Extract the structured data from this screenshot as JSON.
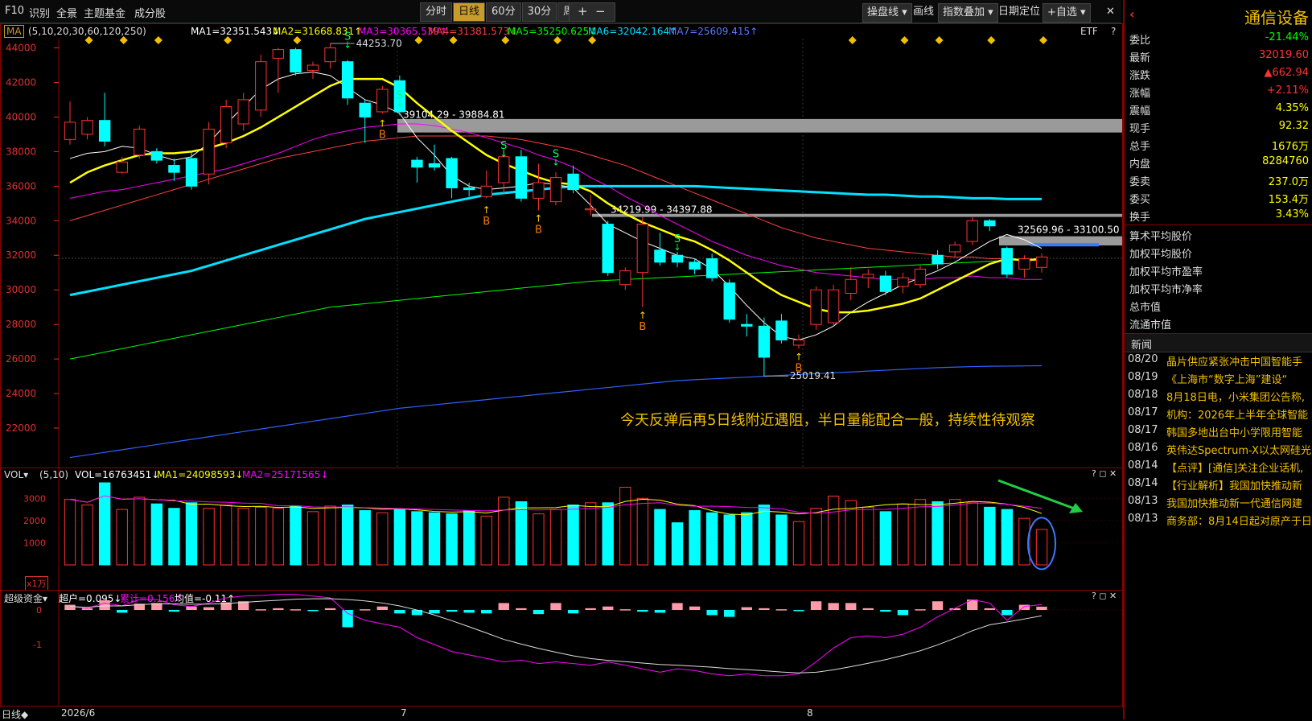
{
  "toolbar": {
    "nav": [
      "F10",
      "识别",
      "全景",
      "主题基金",
      "成分股"
    ],
    "timeframes": [
      "分时",
      "日线",
      "60分",
      "30分",
      "周线"
    ],
    "active_timeframe": "日线",
    "plus": "+",
    "minus": "−",
    "tools": [
      "操盘线",
      "画线",
      "指数叠加",
      "日期定位",
      "+自选"
    ],
    "close": "✕"
  },
  "main_indicator": {
    "name": "MA",
    "params": "(5,10,20,30,60,120,250)",
    "ma1": "MA1=32351.543↓",
    "ma2": "MA2=31668.831↑",
    "ma3": "MA3=30365.539↑",
    "ma4": "MA4=31381.573↓",
    "ma5": "MA5=35250.625↓",
    "ma6": "MA6=32042.164↑",
    "ma7": "MA7=25609.415↑",
    "etf": "ETF",
    "help": "?"
  },
  "price_axis": [
    "44000",
    "42000",
    "40000",
    "38000",
    "36000",
    "34000",
    "32000",
    "30000",
    "28000",
    "26000",
    "24000",
    "22000"
  ],
  "annotations": {
    "high": "44253.70",
    "zone1": "39104.29 - 39884.81",
    "zone2": "34219.99 - 34397.88",
    "zone3": "32569.96 - 33100.50",
    "low": "25019.41",
    "comment": "今天反弹后再5日线附近遇阻，半日量能配合一般，持续性待观察"
  },
  "vol_indicator": {
    "name": "VOL",
    "params": "(5,10)",
    "vol": "VOL=16763451↓",
    "ma1": "MA1=24098593↓",
    "ma2": "MA2=25171565↓",
    "axis": [
      "3000",
      "2000",
      "1000"
    ],
    "unit": "x1万"
  },
  "fund_indicator": {
    "name": "超级资金",
    "super": "超户=0.095↓",
    "cum": "累计=0.156↑",
    "avg": "均值=-0.11↑",
    "axis": [
      "0",
      "-1"
    ]
  },
  "date_axis": {
    "mode": "日线◆",
    "labels": [
      "2026/6",
      "7",
      "8"
    ]
  },
  "colors": {
    "up": "#ff3232",
    "down": "#00ffff",
    "ma5": "#ffffff",
    "ma10": "#ffff00",
    "ma20": "#ff00ff",
    "ma30": "#ff4040",
    "ma60": "#00ff00",
    "ma120": "#00e0ff",
    "ma250": "#3060ff",
    "accent": "#c89b2a"
  },
  "quote": {
    "name": "通信设备",
    "rows": [
      {
        "k": "委比",
        "v": "-21.44%",
        "c": "#00ff00"
      },
      {
        "k": "最新",
        "v": "32019.60",
        "c": "#ff3232"
      },
      {
        "k": "涨跌",
        "v": "▲662.94",
        "c": "#ff3232"
      },
      {
        "k": "涨幅",
        "v": "+2.11%",
        "c": "#ff3232"
      },
      {
        "k": "震幅",
        "v": "4.35%",
        "c": "#ffff00"
      },
      {
        "k": "现手",
        "v": "92.32",
        "c": "#ffff00"
      },
      {
        "k": "总手",
        "v": "1676万",
        "c": "#ffff00"
      },
      {
        "k": "内盘",
        "v": "8284760",
        "c": "#ffff00"
      },
      {
        "k": "委卖",
        "v": "237.0万",
        "c": "#ffff00"
      },
      {
        "k": "委买",
        "v": "153.4万",
        "c": "#ffff00"
      },
      {
        "k": "换手",
        "v": "3.43%",
        "c": "#ffff00"
      }
    ],
    "stats": [
      "算术平均股价",
      "加权平均股价",
      "加权平均市盈率",
      "加权平均市净率",
      "总市值",
      "流通市值"
    ]
  },
  "news": {
    "title": "新闻",
    "items": [
      {
        "d": "08/20",
        "t": "晶片供应紧张冲击中国智能手"
      },
      {
        "d": "08/19",
        "t": "《上海市“数字上海”建设“"
      },
      {
        "d": "08/18",
        "t": "8月18日电，小米集团公告称,"
      },
      {
        "d": "08/17",
        "t": "机构：2026年上半年全球智能"
      },
      {
        "d": "08/17",
        "t": "韩国多地出台中小学限用智能"
      },
      {
        "d": "08/16",
        "t": "英伟达Spectrum-X以太网硅光"
      },
      {
        "d": "08/14",
        "t": "【点评】[通信]关注企业话机,"
      },
      {
        "d": "08/14",
        "t": "【行业解析】我国加快推动新"
      },
      {
        "d": "08/13",
        "t": "我国加快推动新一代通信网建"
      },
      {
        "d": "08/13",
        "t": "商务部：8月14日起对原产于日"
      }
    ]
  },
  "chart_data": {
    "type": "candlestick",
    "title": "",
    "ylim": [
      20000,
      45000
    ],
    "x_labels": [
      "2026/6",
      "7",
      "8"
    ],
    "candles": [
      {
        "o": 38700,
        "c": 39700,
        "h": 40900,
        "l": 38400
      },
      {
        "o": 39000,
        "c": 39800,
        "h": 40000,
        "l": 38700
      },
      {
        "o": 39800,
        "c": 38600,
        "h": 41400,
        "l": 38300
      },
      {
        "o": 36800,
        "c": 37400,
        "h": 37700,
        "l": 36700
      },
      {
        "o": 37800,
        "c": 39300,
        "h": 39500,
        "l": 37600
      },
      {
        "o": 38000,
        "c": 37500,
        "h": 38200,
        "l": 37300
      },
      {
        "o": 37200,
        "c": 36800,
        "h": 37600,
        "l": 36300
      },
      {
        "o": 37600,
        "c": 36000,
        "h": 38000,
        "l": 35800
      },
      {
        "o": 36700,
        "c": 39300,
        "h": 39700,
        "l": 36100
      },
      {
        "o": 38500,
        "c": 40600,
        "h": 41000,
        "l": 38200
      },
      {
        "o": 39600,
        "c": 41000,
        "h": 41400,
        "l": 39200
      },
      {
        "o": 40400,
        "c": 43200,
        "h": 43600,
        "l": 40000
      },
      {
        "o": 43400,
        "c": 43900,
        "h": 44000,
        "l": 41400
      },
      {
        "o": 43900,
        "c": 42600,
        "h": 44000,
        "l": 42400
      },
      {
        "o": 42700,
        "c": 43000,
        "h": 43200,
        "l": 42200
      },
      {
        "o": 43200,
        "c": 44000,
        "h": 44253,
        "l": 42800
      },
      {
        "o": 43200,
        "c": 41100,
        "h": 43300,
        "l": 40700
      },
      {
        "o": 40800,
        "c": 40000,
        "h": 41000,
        "l": 38500
      },
      {
        "o": 40300,
        "c": 41600,
        "h": 41800,
        "l": 40200
      },
      {
        "o": 42100,
        "c": 40300,
        "h": 42400,
        "l": 40100
      },
      {
        "o": 37500,
        "c": 37100,
        "h": 37700,
        "l": 36200
      },
      {
        "o": 37300,
        "c": 37100,
        "h": 38400,
        "l": 36900
      },
      {
        "o": 37600,
        "c": 35900,
        "h": 37700,
        "l": 35300
      },
      {
        "o": 35900,
        "c": 35800,
        "h": 36200,
        "l": 35400
      },
      {
        "o": 35400,
        "c": 36000,
        "h": 36900,
        "l": 35300
      },
      {
        "o": 36200,
        "c": 37700,
        "h": 38200,
        "l": 35600
      },
      {
        "o": 37700,
        "c": 35300,
        "h": 38100,
        "l": 35100
      },
      {
        "o": 35300,
        "c": 36200,
        "h": 37300,
        "l": 34600
      },
      {
        "o": 35100,
        "c": 36500,
        "h": 36800,
        "l": 34900
      },
      {
        "o": 36700,
        "c": 35800,
        "h": 37200,
        "l": 35600
      },
      {
        "o": 34700,
        "c": 34700,
        "h": 35500,
        "l": 34300
      },
      {
        "o": 33800,
        "c": 31000,
        "h": 34000,
        "l": 30800
      },
      {
        "o": 30300,
        "c": 31100,
        "h": 31300,
        "l": 30000
      },
      {
        "o": 31000,
        "c": 33800,
        "h": 34200,
        "l": 29000
      },
      {
        "o": 32300,
        "c": 31600,
        "h": 33300,
        "l": 31400
      },
      {
        "o": 32000,
        "c": 31600,
        "h": 32200,
        "l": 31300
      },
      {
        "o": 31600,
        "c": 31200,
        "h": 31800,
        "l": 30900
      },
      {
        "o": 31800,
        "c": 30700,
        "h": 32100,
        "l": 30500
      },
      {
        "o": 30400,
        "c": 28300,
        "h": 30600,
        "l": 28100
      },
      {
        "o": 28000,
        "c": 27900,
        "h": 28600,
        "l": 27300
      },
      {
        "o": 27900,
        "c": 26100,
        "h": 28400,
        "l": 25019
      },
      {
        "o": 28200,
        "c": 27100,
        "h": 28600,
        "l": 26900
      },
      {
        "o": 26800,
        "c": 27100,
        "h": 27400,
        "l": 26600
      },
      {
        "o": 28000,
        "c": 30000,
        "h": 30200,
        "l": 27700
      },
      {
        "o": 28100,
        "c": 30000,
        "h": 30300,
        "l": 27900
      },
      {
        "o": 29800,
        "c": 30600,
        "h": 31300,
        "l": 29400
      },
      {
        "o": 30700,
        "c": 30900,
        "h": 31200,
        "l": 30100
      },
      {
        "o": 30800,
        "c": 29900,
        "h": 31100,
        "l": 29700
      },
      {
        "o": 30200,
        "c": 30700,
        "h": 31000,
        "l": 29800
      },
      {
        "o": 30300,
        "c": 31200,
        "h": 31400,
        "l": 30100
      },
      {
        "o": 32000,
        "c": 31500,
        "h": 32300,
        "l": 31200
      },
      {
        "o": 32200,
        "c": 32600,
        "h": 32800,
        "l": 31900
      },
      {
        "o": 32800,
        "c": 34000,
        "h": 34200,
        "l": 32600
      },
      {
        "o": 34000,
        "c": 33700,
        "h": 34100,
        "l": 33400
      },
      {
        "o": 32400,
        "c": 30900,
        "h": 32500,
        "l": 30700
      },
      {
        "o": 31200,
        "c": 31800,
        "h": 32000,
        "l": 30700
      },
      {
        "o": 31300,
        "c": 31900,
        "h": 32100,
        "l": 31000
      }
    ],
    "volume": [
      2950,
      2700,
      3700,
      2500,
      3050,
      2750,
      2550,
      2800,
      2550,
      2700,
      2550,
      2600,
      2550,
      2650,
      2400,
      2650,
      2700,
      2450,
      2350,
      2500,
      2400,
      2350,
      2300,
      2450,
      2200,
      3050,
      2850,
      2300,
      2500,
      2700,
      2800,
      2800,
      3500,
      3000,
      2500,
      1900,
      2450,
      2350,
      2250,
      2350,
      2700,
      2250,
      1950,
      2550,
      3100,
      2900,
      2600,
      2400,
      2750,
      2950,
      2850,
      2950,
      2800,
      2600,
      2500,
      2100,
      1600
    ],
    "ma5": [
      37600,
      37900,
      38000,
      38300,
      38200,
      37800,
      37500,
      37700,
      38500,
      39600,
      40600,
      41600,
      42200,
      42500,
      42600,
      42400,
      41700,
      41000,
      40700,
      40200,
      38800,
      37800,
      36600,
      36000,
      35800,
      35900,
      36000,
      36200,
      36100,
      35900,
      34900,
      33800,
      33300,
      32800,
      32400,
      32000,
      31800,
      31200,
      30200,
      29100,
      28100,
      27300,
      27100,
      27400,
      27900,
      28700,
      29300,
      29800,
      30300,
      30700,
      31100,
      31600,
      32200,
      32800,
      33200,
      32900,
      32400
    ],
    "ma10": [
      36200,
      36800,
      37200,
      37500,
      37800,
      37900,
      37900,
      38000,
      38200,
      38500,
      38900,
      39400,
      40000,
      40600,
      41200,
      41800,
      42200,
      42200,
      42200,
      41700,
      40800,
      40000,
      39200,
      38500,
      37800,
      37300,
      36900,
      36500,
      36200,
      36100,
      35700,
      35000,
      34400,
      33900,
      33500,
      33100,
      32800,
      32300,
      31700,
      31000,
      30300,
      29700,
      29300,
      28900,
      28700,
      28700,
      28800,
      29000,
      29200,
      29500,
      30000,
      30500,
      31000,
      31500,
      31800,
      31700,
      31800
    ],
    "ma20": [
      35300,
      35500,
      35700,
      35800,
      36000,
      36200,
      36400,
      36600,
      36800,
      37000,
      37300,
      37600,
      37900,
      38300,
      38700,
      39000,
      39200,
      39400,
      39500,
      39600,
      39600,
      39500,
      39300,
      39100,
      38800,
      38500,
      38200,
      37800,
      37500,
      37100,
      36500,
      36000,
      35400,
      34900,
      34300,
      33800,
      33300,
      32800,
      32400,
      32000,
      31700,
      31400,
      31200,
      31000,
      30900,
      30800,
      30700,
      30600,
      30600,
      30600,
      30700,
      30700,
      30800,
      30700,
      30700,
      30600,
      30600
    ],
    "ma30": [
      34000,
      34300,
      34600,
      34900,
      35200,
      35500,
      35800,
      36100,
      36400,
      36700,
      37000,
      37300,
      37600,
      37800,
      38000,
      38200,
      38400,
      38600,
      38700,
      38800,
      38900,
      38900,
      38900,
      38900,
      38900,
      38800,
      38700,
      38500,
      38300,
      38100,
      37800,
      37500,
      37200,
      36800,
      36400,
      36000,
      35600,
      35200,
      34800,
      34400,
      34000,
      33600,
      33300,
      33000,
      32800,
      32600,
      32400,
      32300,
      32200,
      32100,
      32000,
      31900,
      31900,
      31800,
      31800,
      31700,
      31700
    ],
    "ma60": [
      26000,
      26200,
      26400,
      26600,
      26800,
      27000,
      27200,
      27400,
      27600,
      27800,
      28000,
      28200,
      28400,
      28600,
      28800,
      29000,
      29100,
      29200,
      29300,
      29400,
      29500,
      29600,
      29700,
      29800,
      29900,
      30000,
      30100,
      30200,
      30300,
      30400,
      30500,
      30550,
      30600,
      30650,
      30700,
      30750,
      30800,
      30850,
      30900,
      30950,
      31000,
      31050,
      31100,
      31150,
      31200,
      31250,
      31300,
      31350,
      31400,
      31450,
      31500,
      31550,
      31600,
      31650,
      31700,
      31750,
      31800
    ],
    "ma120": [
      29700,
      29900,
      30100,
      30300,
      30500,
      30700,
      30900,
      31100,
      31400,
      31700,
      32000,
      32300,
      32600,
      32900,
      33200,
      33500,
      33800,
      34100,
      34300,
      34500,
      34700,
      34900,
      35100,
      35300,
      35500,
      35600,
      35700,
      35800,
      35900,
      36000,
      36000,
      36000,
      36000,
      36000,
      36000,
      36000,
      36000,
      35950,
      35900,
      35850,
      35800,
      35750,
      35700,
      35650,
      35600,
      35550,
      35500,
      35500,
      35450,
      35400,
      35400,
      35350,
      35300,
      35300,
      35250,
      35250,
      35250
    ],
    "ma250": [
      20300,
      20450,
      20600,
      20750,
      20900,
      21050,
      21200,
      21350,
      21500,
      21650,
      21800,
      21950,
      22100,
      22250,
      22400,
      22550,
      22700,
      22850,
      23000,
      23150,
      23250,
      23350,
      23450,
      23550,
      23650,
      23750,
      23850,
      23950,
      24050,
      24150,
      24250,
      24350,
      24450,
      24550,
      24650,
      24750,
      24800,
      24850,
      24900,
      24950,
      25000,
      25050,
      25100,
      25150,
      25200,
      25250,
      25300,
      25350,
      25400,
      25450,
      25500,
      25530,
      25560,
      25580,
      25590,
      25600,
      25609
    ]
  }
}
